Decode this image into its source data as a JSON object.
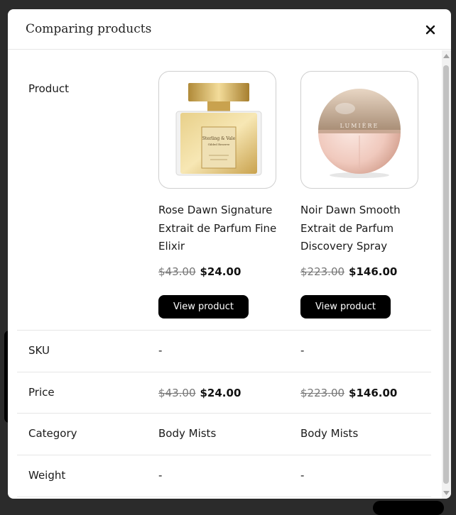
{
  "modal": {
    "title": "Comparing products",
    "close_label": "close"
  },
  "rows": {
    "product": "Product",
    "sku": "SKU",
    "price": "Price",
    "category": "Category",
    "weight": "Weight"
  },
  "products": [
    {
      "name": "Rose Dawn Signature Extrait de Parfum Fine Elixir",
      "old_price": "$43.00",
      "price": "$24.00",
      "button": "View product",
      "sku": "-",
      "category": "Body Mists",
      "weight": "-",
      "image_icon": "gold-perfume-bottle",
      "bottle_label_line1": "Sterling & Vale",
      "bottle_label_line2": "Gilded Reserve"
    },
    {
      "name": "Noir Dawn Smooth Extrait de Parfum Discovery Spray",
      "old_price": "$223.00",
      "price": "$146.00",
      "button": "View product",
      "sku": "-",
      "category": "Body Mists",
      "weight": "-",
      "image_icon": "pink-sphere-perfume-bottle",
      "bottle_label": "LUMIÈRE"
    }
  ],
  "colors": {
    "button_bg": "#000000",
    "overlay": "#2b2b2b",
    "gold": "#d9b75a",
    "rose": "#f0cfc6"
  }
}
